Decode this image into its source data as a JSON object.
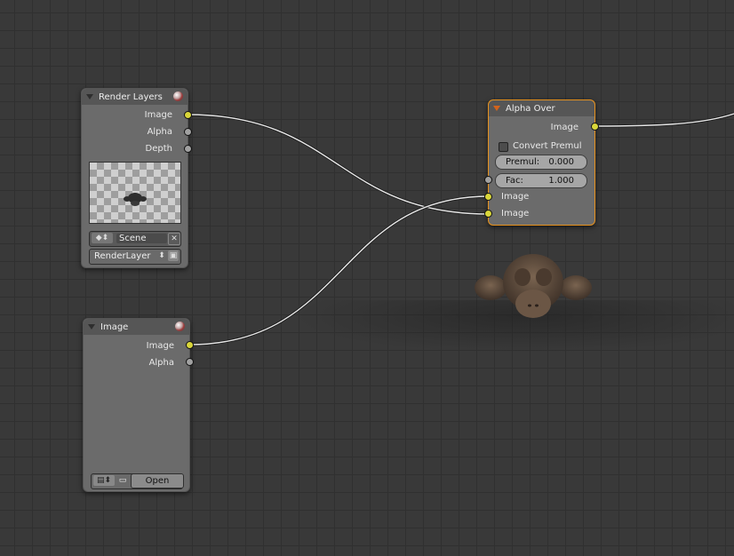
{
  "nodes": {
    "render_layers": {
      "title": "Render Layers",
      "outputs": [
        "Image",
        "Alpha",
        "Depth"
      ],
      "scene_value": "Scene",
      "layer_value": "RenderLayer"
    },
    "image": {
      "title": "Image",
      "outputs": [
        "Image",
        "Alpha"
      ],
      "open_label": "Open"
    },
    "alpha_over": {
      "title": "Alpha Over",
      "output": "Image",
      "convert_premul_label": "Convert Premul",
      "premul_label": "Premul:",
      "premul_value": "0.000",
      "fac_label": "Fac:",
      "fac_value": "1.000",
      "inputs": [
        "Image",
        "Image"
      ]
    }
  },
  "colors": {
    "socket_image": "#d9d63a",
    "socket_value": "#a1a1a1",
    "active_outline": "#e6911d",
    "link": "#e8e8e8"
  },
  "icons": {
    "node_preview_sphere": "material-sphere-icon",
    "collapse_triangle": "triangle-down-icon",
    "scene_browse": "scene-browse-icon",
    "clear": "x-clear-icon",
    "render_layer_browse": "updown-arrows-icon",
    "camera": "camera-icon",
    "image_browse": "image-browse-icon",
    "folder": "folder-icon"
  }
}
